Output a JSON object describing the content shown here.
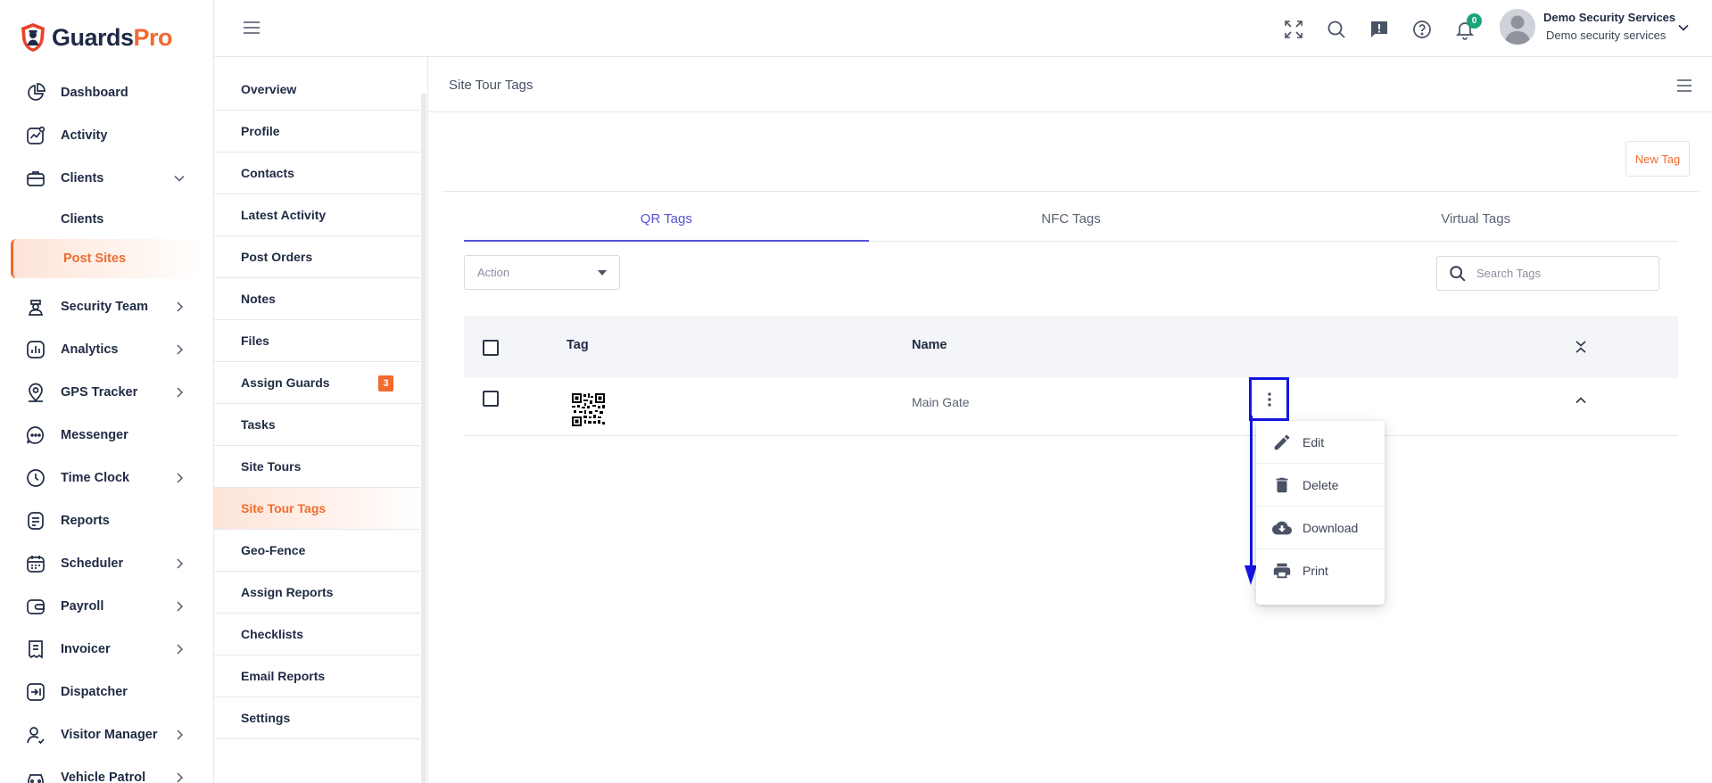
{
  "brand": {
    "name_main": "Guards",
    "name_accent": "Pro",
    "accent": "#f26a2e"
  },
  "nav": {
    "items": [
      {
        "label": "Dashboard",
        "icon": "dashboard-icon",
        "chevron": false
      },
      {
        "label": "Activity",
        "icon": "activity-icon",
        "chevron": false
      },
      {
        "label": "Clients",
        "icon": "clients-icon",
        "chevron": "down"
      }
    ],
    "clients_sub": [
      {
        "label": "Clients"
      },
      {
        "label": "Post Sites",
        "active": true
      }
    ],
    "items2": [
      {
        "label": "Security Team",
        "icon": "security-team-icon",
        "chevron": "right"
      },
      {
        "label": "Analytics",
        "icon": "analytics-icon",
        "chevron": "right"
      },
      {
        "label": "GPS Tracker",
        "icon": "gps-icon",
        "chevron": "right"
      },
      {
        "label": "Messenger",
        "icon": "messenger-icon",
        "chevron": false
      },
      {
        "label": "Time Clock",
        "icon": "clock-icon",
        "chevron": "right"
      },
      {
        "label": "Reports",
        "icon": "reports-icon",
        "chevron": false
      },
      {
        "label": "Scheduler",
        "icon": "scheduler-icon",
        "chevron": "right"
      },
      {
        "label": "Payroll",
        "icon": "payroll-icon",
        "chevron": "right"
      },
      {
        "label": "Invoicer",
        "icon": "invoicer-icon",
        "chevron": "right"
      },
      {
        "label": "Dispatcher",
        "icon": "dispatcher-icon",
        "chevron": false
      },
      {
        "label": "Visitor Manager",
        "icon": "visitor-icon",
        "chevron": "right"
      },
      {
        "label": "Vehicle Patrol",
        "icon": "vehicle-icon",
        "chevron": "right"
      }
    ]
  },
  "topbar": {
    "notification_count": "0",
    "user_name": "Demo Security Services",
    "user_company": "Demo security services"
  },
  "submenu": {
    "items": [
      {
        "label": "Overview"
      },
      {
        "label": "Profile"
      },
      {
        "label": "Contacts"
      },
      {
        "label": "Latest Activity"
      },
      {
        "label": "Post Orders"
      },
      {
        "label": "Notes"
      },
      {
        "label": "Files"
      },
      {
        "label": "Assign Guards",
        "badge": "3"
      },
      {
        "label": "Tasks"
      },
      {
        "label": "Site Tours"
      },
      {
        "label": "Site Tour Tags",
        "active": true
      },
      {
        "label": "Geo-Fence"
      },
      {
        "label": "Assign Reports"
      },
      {
        "label": "Checklists"
      },
      {
        "label": "Email Reports"
      },
      {
        "label": "Settings"
      }
    ]
  },
  "page": {
    "title": "Site Tour Tags",
    "new_tag_label": "New Tag",
    "tabs": [
      {
        "label": "QR Tags",
        "active": true
      },
      {
        "label": "NFC Tags"
      },
      {
        "label": "Virtual Tags"
      }
    ],
    "action_placeholder": "Action",
    "search_placeholder": "Search Tags",
    "table": {
      "headers": {
        "tag": "Tag",
        "name": "Name"
      },
      "rows": [
        {
          "name": "Main Gate"
        }
      ]
    },
    "row_menu": [
      {
        "label": "Edit",
        "icon": "pencil-icon"
      },
      {
        "label": "Delete",
        "icon": "trash-icon"
      },
      {
        "label": "Download",
        "icon": "cloud-download-icon"
      },
      {
        "label": "Print",
        "icon": "printer-icon"
      }
    ]
  },
  "colors": {
    "accent": "#f26a2e",
    "tab_active": "#5551d8",
    "annotation": "#1414e6",
    "badge_green": "#1aa37a"
  }
}
